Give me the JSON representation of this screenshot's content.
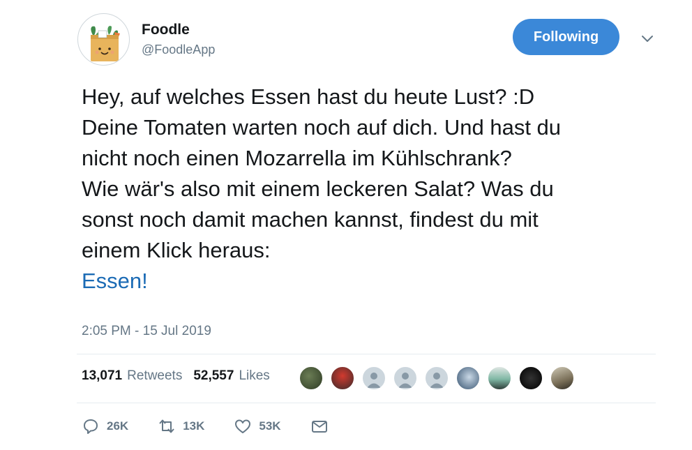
{
  "account": {
    "display_name": "Foodle",
    "handle": "@FoodleApp"
  },
  "follow_button": {
    "label": "Following"
  },
  "tweet": {
    "lines": [
      "Hey, auf welches Essen hast du heute Lust? :D",
      "Deine Tomaten warten noch auf dich. Und hast du",
      "nicht noch einen Mozarrella im Kühlschrank?",
      "Wie wär's also mit einem leckeren Salat? Was du",
      "sonst noch damit machen kannst, findest du mit",
      "einem Klick heraus:"
    ],
    "link_text": "Essen!",
    "timestamp": "2:05 PM - 15 Jul 2019"
  },
  "stats": {
    "retweets_count": "13,071",
    "retweets_label": "Retweets",
    "likes_count": "52,557",
    "likes_label": "Likes"
  },
  "actions": {
    "reply_count": "26K",
    "retweet_count": "13K",
    "like_count": "53K"
  },
  "colors": {
    "follow_button": "#3b88d8",
    "link": "#1b6bb5",
    "muted": "#657786"
  },
  "icons": [
    "chevron-down-icon",
    "reply-icon",
    "retweet-icon",
    "heart-icon",
    "envelope-icon"
  ]
}
